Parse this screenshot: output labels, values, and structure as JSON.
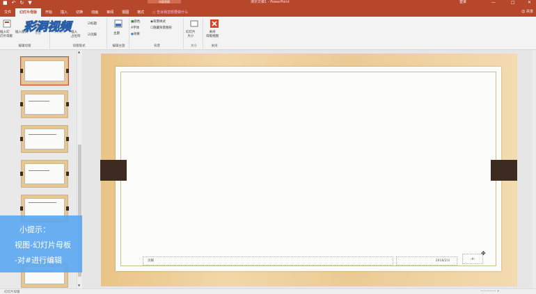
{
  "titlebar": {
    "qat": [
      "■",
      "↶",
      "↻",
      "▼"
    ],
    "context_tab": "母版视图",
    "doc_title": "演示文稿1 - PowerPoint",
    "signin": "登录",
    "min": "—",
    "max": "□",
    "close": "✕"
  },
  "tabs": [
    {
      "label": "文件"
    },
    {
      "label": "幻灯片母版",
      "active": true
    },
    {
      "label": "开始"
    },
    {
      "label": "插入"
    },
    {
      "label": "切换"
    },
    {
      "label": "动画"
    },
    {
      "label": "审阅"
    },
    {
      "label": "视图"
    },
    {
      "label": "格式"
    }
  ],
  "tell_me": "告诉我您想要做什么",
  "share": "共享",
  "ribbon": {
    "insert_master": "插入幻",
    "insert_master2": "灯片母版",
    "insert_layout": "插入版式",
    "rename": "重命名",
    "delete": "删除",
    "preserve": "保留",
    "group_edit_master": "编辑母版",
    "master_layout": "母版版式",
    "insert_placeholder": "插入",
    "insert_placeholder2": "占位符",
    "title_chk": "标题",
    "footer_chk": "页脚",
    "group_master_layout": "母版版式",
    "themes": "主题",
    "group_edit_theme": "编辑主题",
    "colors": "颜色",
    "fonts": "字体",
    "effects": "效果",
    "bg_styles": "背景样式",
    "hide_bg": "隐藏背景图形",
    "group_background": "背景",
    "slide_size": "幻灯片",
    "slide_size2": "大小",
    "group_size": "大小",
    "close_master": "关闭",
    "close_master2": "母版视图",
    "group_close": "关闭"
  },
  "watermark": "彩洞视频",
  "tip": {
    "line1": "小提示：",
    "line2": "视图-幻灯片母板",
    "line3": "-对#进行编辑"
  },
  "slide": {
    "footer_text": "页脚",
    "date_text": "2018/2/3",
    "page_num": "‹#›"
  },
  "statusbar": {
    "left": "幻灯片母版",
    "right": "————— +"
  },
  "colors": {
    "accent": "#b7472a",
    "tip_bg": "#5ca8f0",
    "wood": "#eccb94",
    "clip": "#3d2b22"
  }
}
